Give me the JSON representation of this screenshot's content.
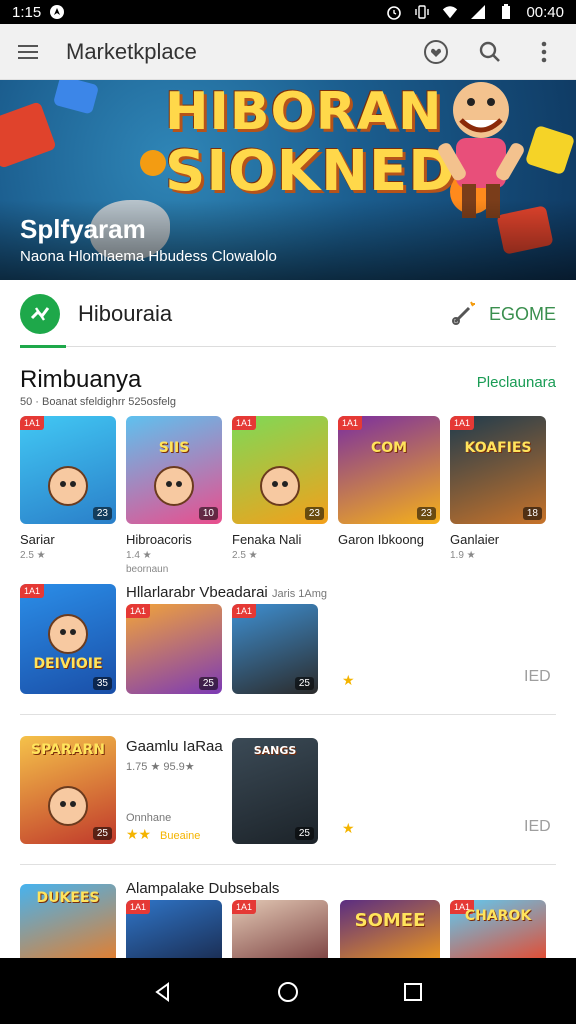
{
  "status_bar": {
    "time_left": "1:15",
    "time_right": "00:40"
  },
  "app_bar": {
    "title": "Marketkplace"
  },
  "hero": {
    "headline_line1": "HIBORAN",
    "headline_line2": "SIOKNED",
    "title": "Splfyaram",
    "subtitle": "Naona Hlomlaema Hbudess Clowalolo"
  },
  "featured": {
    "name": "Hibouraia",
    "cta": "EGOME"
  },
  "section1": {
    "heading": "Rimbuanya",
    "more": "Pleclaunara",
    "sub": "50 · Boanat sfeldighrr  525osfelg",
    "items": [
      {
        "name": "Sariar",
        "meta": "2.5 ★",
        "tag": "1A1",
        "corner": "23",
        "art": ""
      },
      {
        "name": "Hibroacoris",
        "meta": "1.4 ★",
        "tag": "",
        "corner": "10",
        "art": "SIIS"
      },
      {
        "name": "Fenaka Nali",
        "meta": "2.5 ★",
        "tag": "1A1",
        "corner": "23",
        "art": ""
      },
      {
        "name": "Garon Ibkoong",
        "meta": "",
        "tag": "1A1",
        "corner": "23",
        "art": "COM"
      },
      {
        "name": "Ganlaier",
        "meta": "1.9 ★",
        "tag": "1A1",
        "corner": "18",
        "art": "KOAFIES"
      }
    ],
    "item2_extra": "beornaun"
  },
  "row1": {
    "title": "Hllarlarabr Vbeadarai",
    "title_note": "Jaris 1Amg",
    "tiles": [
      {
        "tag": "1A1",
        "corner": "35",
        "art": "DEIVIOIE"
      },
      {
        "tag": "1A1",
        "corner": "25",
        "art": ""
      },
      {
        "tag": "1A1",
        "corner": "25",
        "art": ""
      }
    ],
    "price": "IED"
  },
  "row2": {
    "title": "Gaamlu IaRaa",
    "meta": "1.75 ★  95.9★",
    "sub": "Onnhane",
    "rating_text": "Bueaine",
    "tiles": [
      {
        "tag": "",
        "corner": "25",
        "art": "SPARARN"
      },
      {
        "tag": "",
        "corner": "25",
        "art": "SANGS"
      }
    ],
    "price": "IED"
  },
  "row3": {
    "title": "Alampalake Dubsebals",
    "tiles": [
      {
        "tag": "",
        "corner": "",
        "art": "DUKEES"
      },
      {
        "tag": "1A1",
        "corner": "",
        "art": ""
      },
      {
        "tag": "1A1",
        "corner": "",
        "art": ""
      },
      {
        "tag": "",
        "corner": "",
        "art": "SOMEE"
      },
      {
        "tag": "1A1",
        "corner": "",
        "art": "CHAROK"
      }
    ]
  },
  "colors": {
    "accent_green": "#1ea84a",
    "link_green": "#1a9c55",
    "status_black": "#000000",
    "badge_red": "#e53935",
    "star_yellow": "#f4b400"
  },
  "icons": [
    "menu-icon",
    "heart-icon",
    "search-icon",
    "more-vert-icon",
    "back-icon",
    "home-icon",
    "recents-icon"
  ]
}
